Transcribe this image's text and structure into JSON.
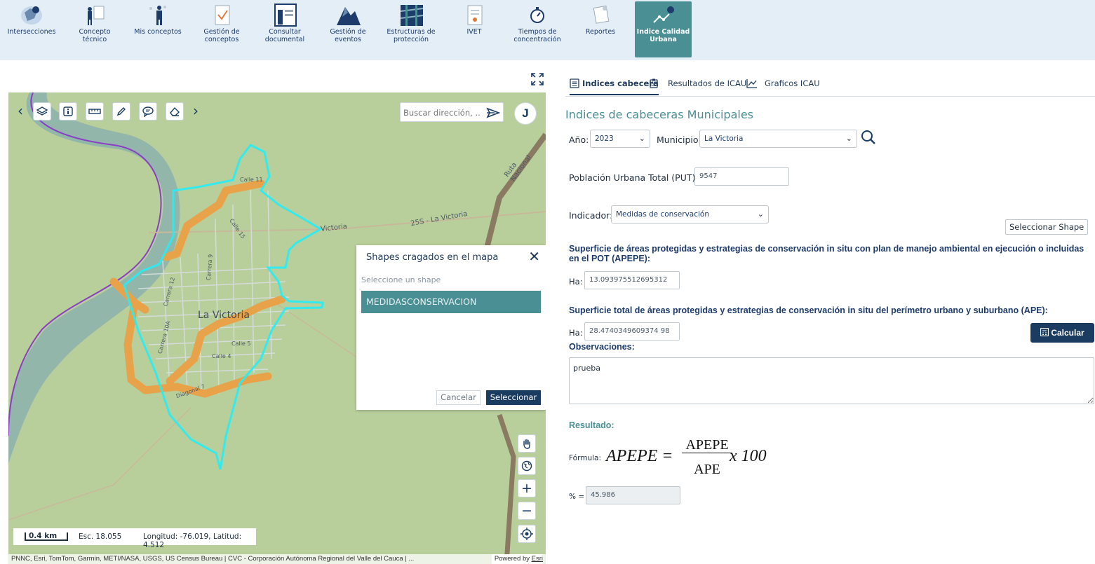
{
  "nav": {
    "items": [
      {
        "label": "Intersecciones",
        "icon": "globe-map-icon"
      },
      {
        "label": "Concepto técnico",
        "icon": "presenter-icon"
      },
      {
        "label": "Mis conceptos",
        "icon": "person-icon"
      },
      {
        "label": "Gestión de conceptos",
        "icon": "document-check-icon"
      },
      {
        "label": "Consultar documental",
        "icon": "archive-icon"
      },
      {
        "label": "Gestión de eventos",
        "icon": "mountain-icon"
      },
      {
        "label": "Estructuras de protección",
        "icon": "wall-icon"
      },
      {
        "label": "IVET",
        "icon": "report-icon"
      },
      {
        "label": "Tiempos de concentración",
        "icon": "stopwatch-icon"
      },
      {
        "label": "Reportes",
        "icon": "report-icon"
      },
      {
        "label": "Indice Calidad Urbana",
        "icon": "urban-quality-icon",
        "active": true
      }
    ]
  },
  "map": {
    "search_placeholder": "Buscar dirección, ...",
    "user_initial": "J",
    "labels": {
      "town": "La Victoria",
      "road_1": "25S - La Victoria",
      "road_2": "Victoria",
      "road_3": "Ruta Nacional",
      "carrera_9": "Carrera 9",
      "carrera_12": "Carrera 12",
      "carrera_10a": "Carrera 10A",
      "calle_15": "Calle 15",
      "calle_5": "Calle 5",
      "calle_4": "Calle 4",
      "calle_11": "Calle 11",
      "diagonal": "Diagonal 7"
    },
    "scale": {
      "length": "0.4 km",
      "esc": "Esc. 18.055",
      "coords": "Longitud: -76.019, Latitud: 4.512"
    },
    "attribution": "PNNC, Esri, TomTom, Garmin, METI/NASA, USGS, US Census Bureau | CVC - Corporación Autónoma Regional del Valle del Cauca | ...",
    "powered_by": "Powered by",
    "powered_brand": "Esri",
    "zoom_in": "+",
    "zoom_out": "−"
  },
  "shape_dialog": {
    "title": "Shapes cragados en el mapa",
    "hint": "Seleccione un shape",
    "option": "MEDIDASCONSERVACION",
    "cancel": "Cancelar",
    "select": "Seleccionar",
    "close": "✕"
  },
  "panel": {
    "tabs": [
      "Indices cabecera",
      "Resultados de ICAU",
      "Graficos ICAU"
    ],
    "heading": "Indices de cabeceras Municipales",
    "year_label": "Año:",
    "year_value": "2023",
    "municipio_label": "Municipio:",
    "municipio_value": "La Victoria",
    "put_label": "Población Urbana Total (PUT):",
    "put_value": "9547",
    "indicator_label": "Indicador:",
    "indicator_value": "Medidas de conservación",
    "select_shape_btn": "Seleccionar Shape",
    "apepe_desc": "Superficie de áreas protegidas y estrategias de conservación in situ con plan de manejo ambiental en ejecución o incluidas en el POT (APEPE):",
    "ha_label": "Ha:",
    "apepe_value": "13.093975512695312",
    "ape_desc": "Superficie total de áreas protegidas y estrategias de conservación in situ del perímetro urbano y suburbano (APE):",
    "ape_value": "28.4740349609374 98",
    "calc_btn": "Calcular",
    "obs_label": "Observaciones:",
    "obs_value": "prueba",
    "result_label": "Resultado:",
    "formula_label": "Fórmula:",
    "formula_lhs": "APEPE =",
    "formula_num": "APEPE",
    "formula_den": "APE",
    "formula_tail": "x 100",
    "pct_label": "% =",
    "pct_value": "45.986"
  }
}
